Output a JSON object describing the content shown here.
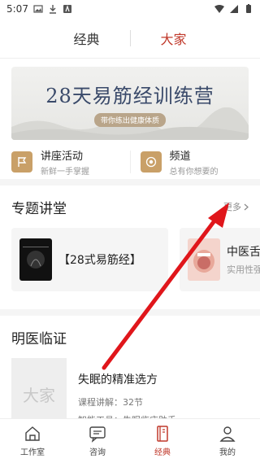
{
  "status_bar": {
    "time": "5:07"
  },
  "top_tabs": [
    {
      "label": "经典"
    },
    {
      "label": "大家"
    }
  ],
  "banner": {
    "title": "28天易筋经训练营",
    "subtitle": "带你练出健康体质"
  },
  "entries": [
    {
      "title": "讲座活动",
      "subtitle": "新鲜一手掌握"
    },
    {
      "title": "频道",
      "subtitle": "总有你想要的"
    }
  ],
  "topics_section": {
    "title": "专题讲堂",
    "more": "更多",
    "items": [
      {
        "name": "【28式易筋经】",
        "sub": ""
      },
      {
        "name": "中医舌",
        "sub": "实用性强"
      }
    ]
  },
  "course_section": {
    "title": "明医临证",
    "thumb_text": "大家",
    "item": {
      "title": "失眠的精准选方",
      "lessons": "课程讲解：32节",
      "tool": "智能工具：失眠临床助手"
    }
  },
  "bottom_nav": [
    {
      "label": "工作室",
      "icon": "house-icon"
    },
    {
      "label": "咨询",
      "icon": "chat-icon"
    },
    {
      "label": "经典",
      "icon": "book-icon"
    },
    {
      "label": "我的",
      "icon": "person-icon"
    }
  ],
  "colors": {
    "accent": "#c0392b",
    "gold": "#c9a068",
    "arrow": "#e0161b"
  }
}
